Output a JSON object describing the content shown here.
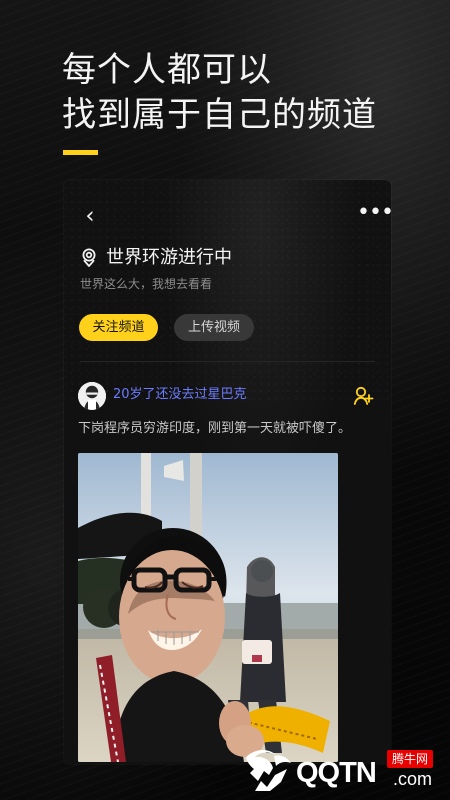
{
  "headline": {
    "line_1": "每个人都可以",
    "line_2": "找到属于自己的频道"
  },
  "colors": {
    "accent": "#ffd119",
    "background": "#000000",
    "card": "#111111",
    "author_link": "#6b7cff",
    "logo_badge": "#e60000"
  },
  "card": {
    "toolbar": {
      "back_icon": "chevron-left-icon",
      "more_icon": "more-horizontal-icon"
    },
    "channel": {
      "title": "世界环游进行中",
      "subtitle": "世界这么大，我想去看看",
      "location_icon": "location-pin-icon"
    },
    "actions": {
      "follow_label": "关注频道",
      "upload_label": "上传视频"
    },
    "post": {
      "author_name": "20岁了还没去过星巴克",
      "add_friend_icon": "add-user-icon",
      "text": "下岗程序员穷游印度，刚到第一天就被吓傻了。"
    }
  },
  "footer": {
    "logo_text": "QQTN",
    "logo_domain": ".com",
    "logo_badge": "腾牛网"
  }
}
